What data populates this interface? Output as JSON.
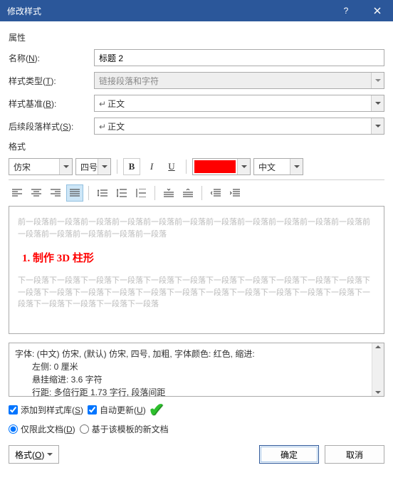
{
  "dialog": {
    "title": "修改样式"
  },
  "sections": {
    "properties": "属性",
    "format": "格式"
  },
  "properties": {
    "name_label": "名称(N):",
    "name_value": "标题 2",
    "type_label": "样式类型(T):",
    "type_value": "链接段落和字符",
    "based_on_label": "样式基准(B):",
    "based_on_value": "正文",
    "following_label": "后续段落样式(S):",
    "following_value": "正文"
  },
  "format_bar": {
    "font": "仿宋",
    "size": "四号",
    "bold": "B",
    "italic": "I",
    "underline": "U",
    "color": "#ff0000",
    "lang": "中文"
  },
  "preview": {
    "grey_prev": "前一段落前一段落前一段落前一段落前一段落前一段落前一段落前一段落前一段落前一段落前一段落前一段落前一段落前一段落前一段落前一段落",
    "sample": "1. 制作 3D 柱形",
    "grey_next_1": "下一段落下一段落下一段落下一段落下一段落下一段落下一段落下一段落下一段落下一段落下一段落下一段落下一段落下一段落下一段落下一段落下一段落下一段落下一段落下一段落下一段落下一段落下一段落下一段落下一段落下一段落下一段落"
  },
  "description": {
    "line1": "字体: (中文) 仿宋, (默认) 仿宋, 四号, 加粗, 字体颜色: 红色, 缩进:",
    "line2": "左侧:  0 厘米",
    "line3": "悬挂缩进: 3.6 字符",
    "line4": "行距: 多倍行距 1.73 字行, 段落间距"
  },
  "options": {
    "add_to_gallery": "添加到样式库(S)",
    "auto_update": "自动更新(U)",
    "only_this_doc": "仅限此文档(D)",
    "based_on_template": "基于该模板的新文档"
  },
  "footer": {
    "format_btn": "格式(O)",
    "ok": "确定",
    "cancel": "取消"
  }
}
